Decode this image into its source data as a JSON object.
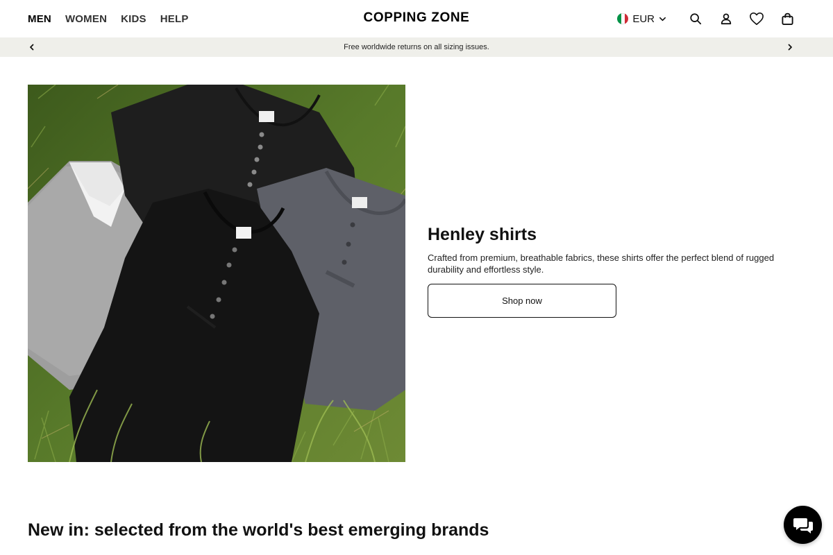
{
  "header": {
    "nav": [
      {
        "label": "MEN",
        "active": true
      },
      {
        "label": "WOMEN"
      },
      {
        "label": "KIDS"
      },
      {
        "label": "HELP"
      }
    ],
    "logo": "COPPING ZONE",
    "currency": {
      "label": "EUR",
      "flag_colors": [
        "#009246",
        "#ffffff",
        "#ce2b37"
      ],
      "icon": "chevron-down-icon"
    },
    "icons": [
      "search-icon",
      "account-icon",
      "wishlist-heart-icon",
      "cart-bag-icon"
    ]
  },
  "announcement": {
    "text": "Free worldwide returns on all sizing issues.",
    "background": "#efefea",
    "prev_icon": "chevron-left-icon",
    "next_icon": "chevron-right-icon"
  },
  "hero": {
    "title": "Henley shirts",
    "description": "Crafted from premium, breathable fabrics, these shirts offer the perfect blend of rugged durability and effortless style.",
    "button_label": "Shop now"
  },
  "section": {
    "title": "New in: selected from the world's best emerging brands"
  },
  "chat": {
    "icon": "chat-bubbles-icon",
    "color": "#000000"
  }
}
